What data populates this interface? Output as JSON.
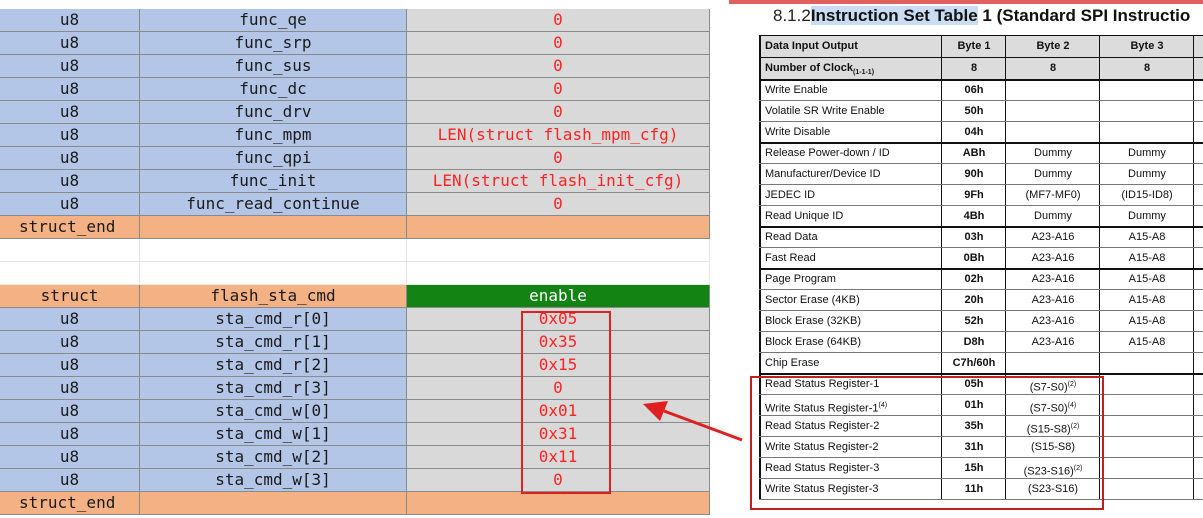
{
  "sheet": {
    "top_rows": [
      {
        "type": "u8",
        "name": "func_qe",
        "value": "0"
      },
      {
        "type": "u8",
        "name": "func_srp",
        "value": "0"
      },
      {
        "type": "u8",
        "name": "func_sus",
        "value": "0"
      },
      {
        "type": "u8",
        "name": "func_dc",
        "value": "0"
      },
      {
        "type": "u8",
        "name": "func_drv",
        "value": "0"
      },
      {
        "type": "u8",
        "name": "func_mpm",
        "value": "LEN(struct flash_mpm_cfg)"
      },
      {
        "type": "u8",
        "name": "func_qpi",
        "value": "0"
      },
      {
        "type": "u8",
        "name": "func_init",
        "value": "LEN(struct flash_init_cfg)"
      },
      {
        "type": "u8",
        "name": "func_read_continue",
        "value": "0"
      }
    ],
    "struct_end_label": "struct_end",
    "header": {
      "struct": "struct",
      "name": "flash_sta_cmd",
      "enable": "enable"
    },
    "bottom_rows": [
      {
        "type": "u8",
        "name": "sta_cmd_r[0]",
        "value": "0x05"
      },
      {
        "type": "u8",
        "name": "sta_cmd_r[1]",
        "value": "0x35"
      },
      {
        "type": "u8",
        "name": "sta_cmd_r[2]",
        "value": "0x15"
      },
      {
        "type": "u8",
        "name": "sta_cmd_r[3]",
        "value": "0"
      },
      {
        "type": "u8",
        "name": "sta_cmd_w[0]",
        "value": "0x01"
      },
      {
        "type": "u8",
        "name": "sta_cmd_w[1]",
        "value": "0x31"
      },
      {
        "type": "u8",
        "name": "sta_cmd_w[2]",
        "value": "0x11"
      },
      {
        "type": "u8",
        "name": "sta_cmd_w[3]",
        "value": "0"
      }
    ],
    "struct_end_label_2": "struct_end"
  },
  "datasheet": {
    "title_num": "8.1.2",
    "title_hl": "Instruction Set Table",
    "title_rest": " 1 (Standard SPI Instructio",
    "header": {
      "name": "Data Input Output",
      "b1": "Byte 1",
      "b2": "Byte 2",
      "b3": "Byte 3"
    },
    "clock": {
      "name": "Number of Clock",
      "sub": "(1-1-1)",
      "b1": "8",
      "b2": "8",
      "b3": "8"
    },
    "rows": [
      {
        "name": "Write Enable",
        "b1": "06h",
        "b2": "",
        "b3": ""
      },
      {
        "name": "Volatile SR Write Enable",
        "b1": "50h",
        "b2": "",
        "b3": ""
      },
      {
        "name": "Write Disable",
        "b1": "04h",
        "b2": "",
        "b3": ""
      },
      {
        "name": "Release Power-down / ID",
        "b1": "ABh",
        "b2": "Dummy",
        "b3": "Dummy"
      },
      {
        "name": "Manufacturer/Device ID",
        "b1": "90h",
        "b2": "Dummy",
        "b3": "Dummy"
      },
      {
        "name": "JEDEC ID",
        "b1": "9Fh",
        "b2": "(MF7-MF0)",
        "b3": "(ID15-ID8)"
      },
      {
        "name": "Read Unique ID",
        "b1": "4Bh",
        "b2": "Dummy",
        "b3": "Dummy"
      },
      {
        "name": "Read Data",
        "b1": "03h",
        "b2": "A23-A16",
        "b3": "A15-A8"
      },
      {
        "name": "Fast Read",
        "b1": "0Bh",
        "b2": "A23-A16",
        "b3": "A15-A8"
      },
      {
        "name": "Page Program",
        "b1": "02h",
        "b2": "A23-A16",
        "b3": "A15-A8"
      },
      {
        "name": "Sector Erase (4KB)",
        "b1": "20h",
        "b2": "A23-A16",
        "b3": "A15-A8"
      },
      {
        "name": "Block Erase (32KB)",
        "b1": "52h",
        "b2": "A23-A16",
        "b3": "A15-A8"
      },
      {
        "name": "Block Erase (64KB)",
        "b1": "D8h",
        "b2": "A23-A16",
        "b3": "A15-A8"
      },
      {
        "name": "Chip Erase",
        "b1": "C7h/60h",
        "b2": "",
        "b3": ""
      },
      {
        "name": "Read Status Register-1",
        "b1": "05h",
        "b2": "(S7-S0)",
        "sup2": "(2)",
        "b3": ""
      },
      {
        "name": "Write Status Register-1",
        "sup1": "(4)",
        "b1": "01h",
        "b2": "(S7-S0)",
        "sup2": "(4)",
        "b3": ""
      },
      {
        "name": "Read Status Register-2",
        "b1": "35h",
        "b2": "(S15-S8)",
        "sup2": "(2)",
        "b3": ""
      },
      {
        "name": "Write Status Register-2",
        "b1": "31h",
        "b2": "(S15-S8)",
        "b3": ""
      },
      {
        "name": "Read Status Register-3",
        "b1": "15h",
        "b2": "(S23-S16)",
        "sup2": "(2)",
        "b3": ""
      },
      {
        "name": "Write Status Register-3",
        "b1": "11h",
        "b2": "(S23-S16)",
        "b3": ""
      }
    ]
  },
  "colors": {
    "blue_cell": "#b4c6e7",
    "gray_cell": "#d9d9d9",
    "orange_cell": "#f4b183",
    "green_header": "#138313",
    "red_text": "#f22222",
    "annotation_red": "#e02020"
  }
}
